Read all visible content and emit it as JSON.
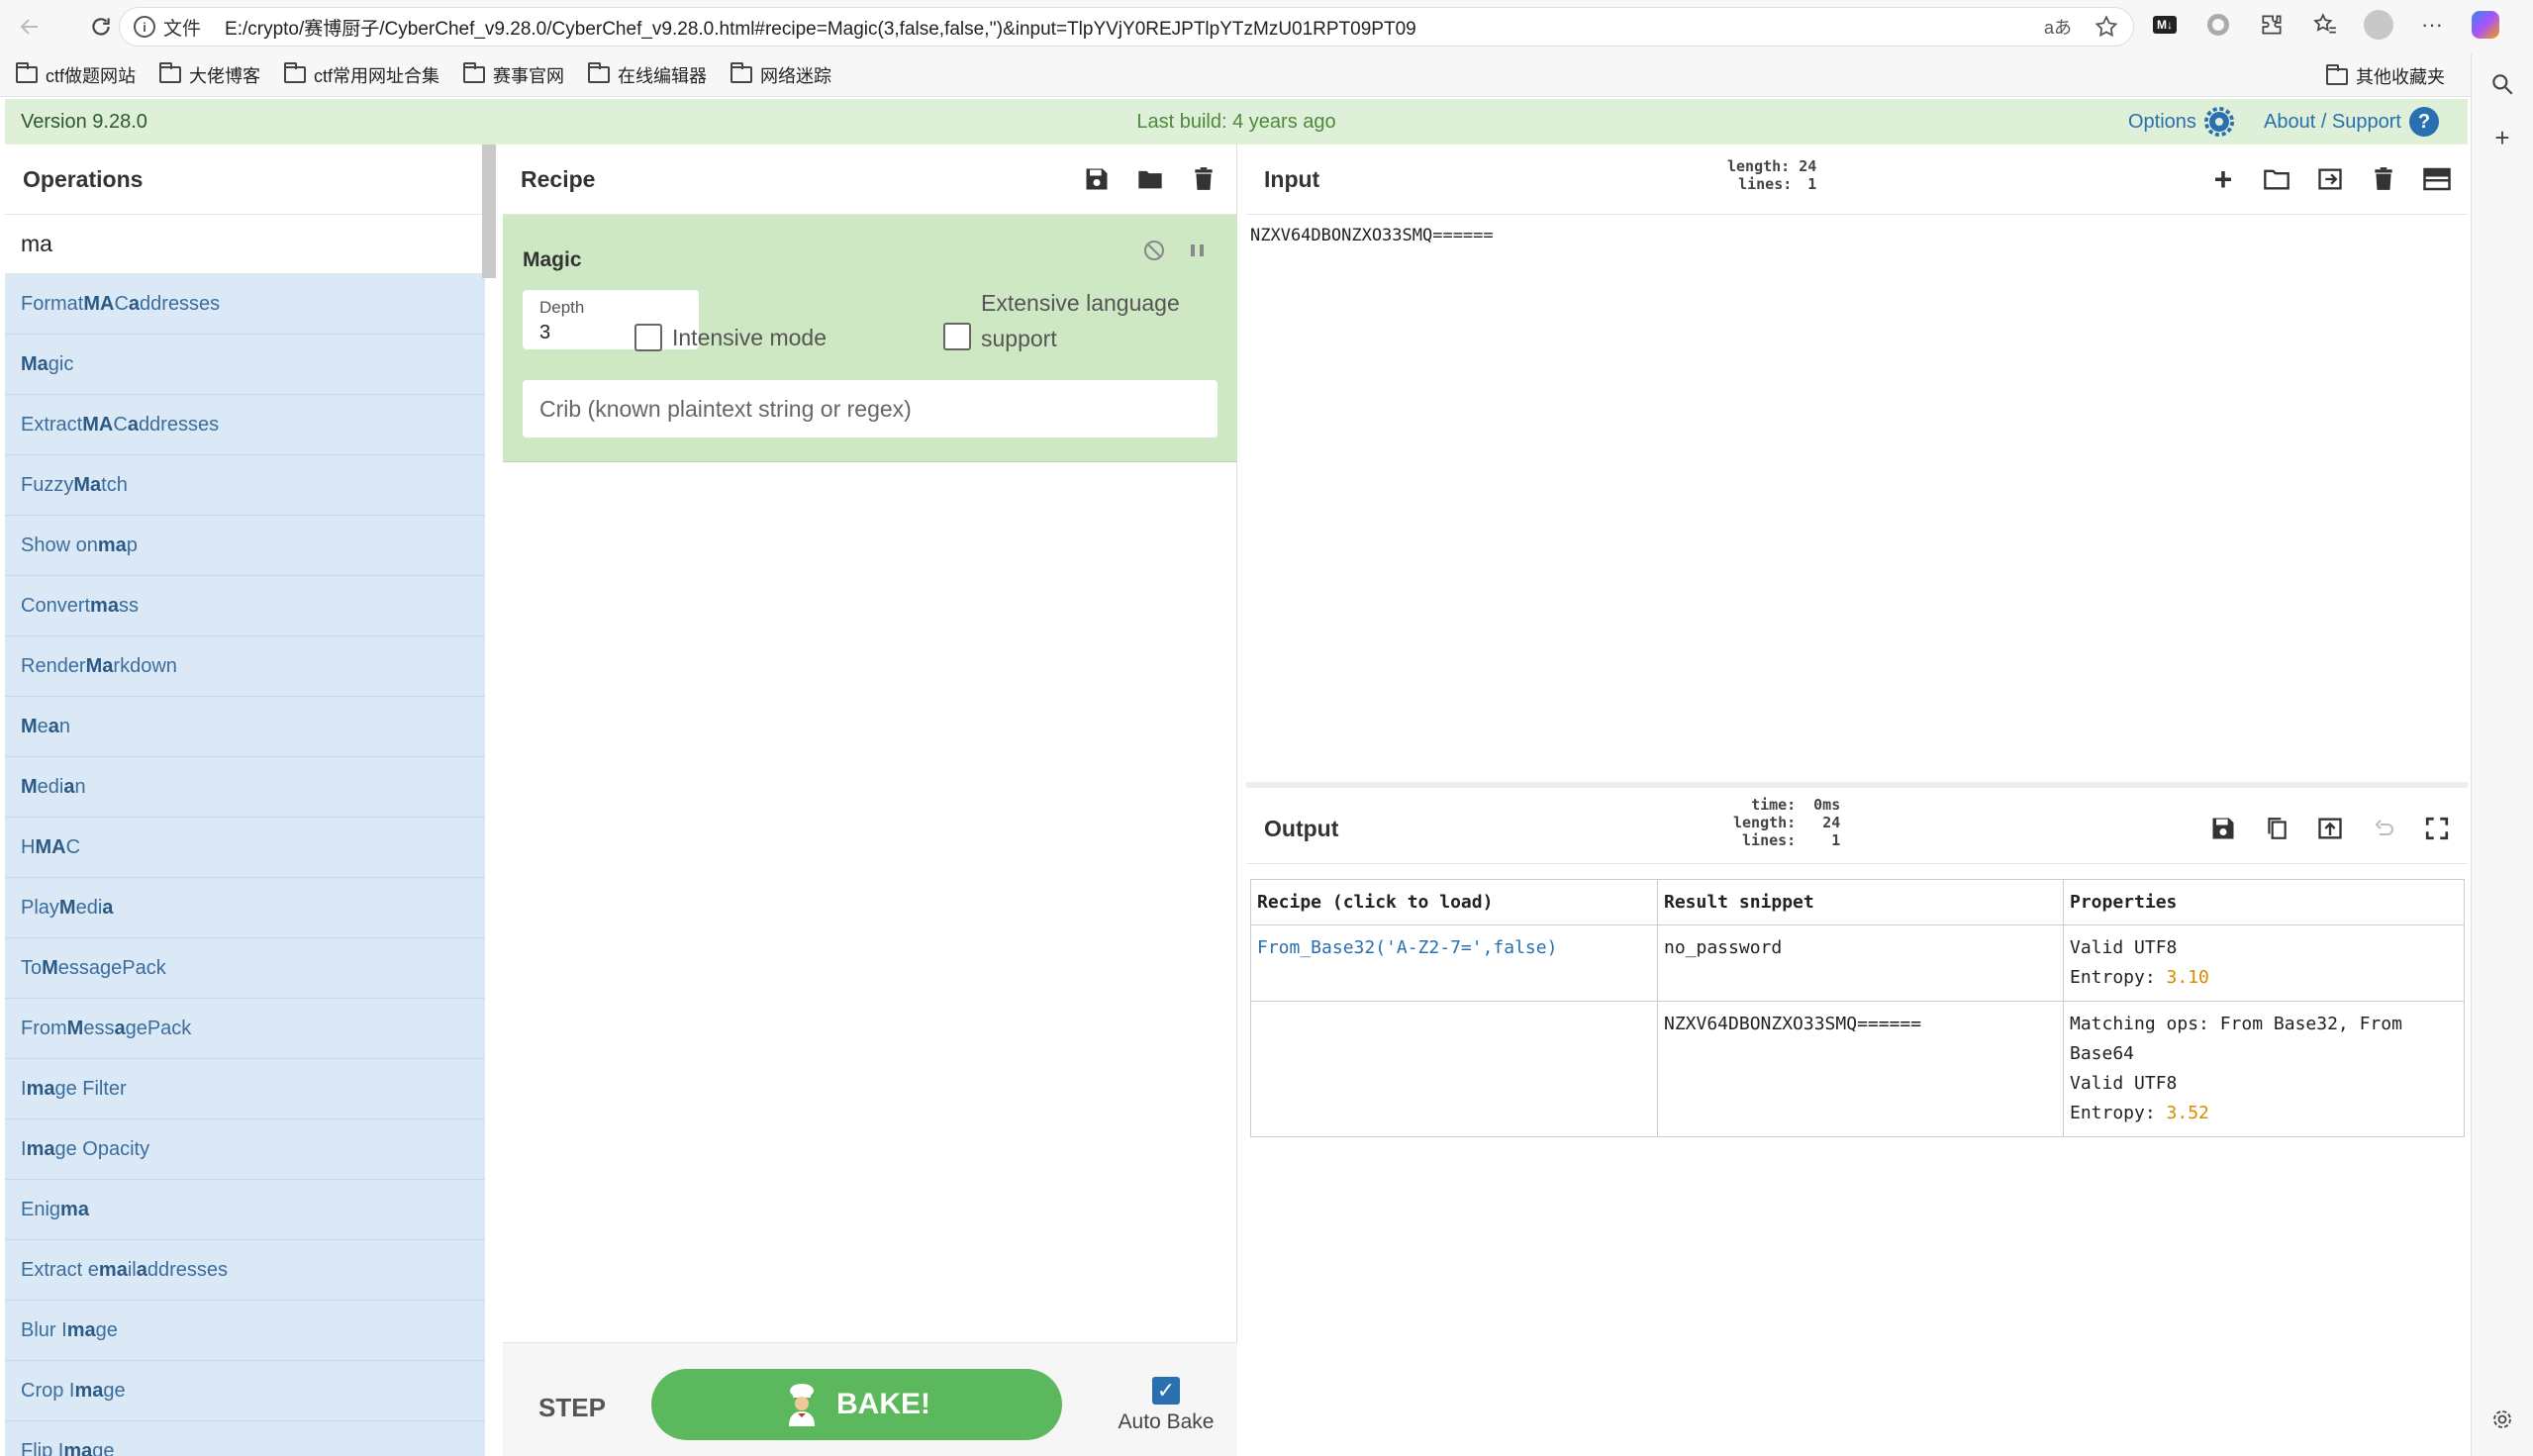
{
  "browser": {
    "file_label": "文件",
    "url": "E:/crypto/赛博厨子/CyberChef_v9.28.0/CyberChef_v9.28.0.html#recipe=Magic(3,false,false,'')&input=TlpYVjY0REJPTlpYTzMzU01RPT09PT09",
    "bookmarks": [
      "ctf做题网站",
      "大佬博客",
      "ctf常用网址合集",
      "赛事官网",
      "在线编辑器",
      "网络迷踪"
    ],
    "other_bookmarks": "其他收藏夹"
  },
  "banner": {
    "version": "Version 9.28.0",
    "last_build": "Last build: 4 years ago",
    "options": "Options",
    "about": "About / Support"
  },
  "operations": {
    "title": "Operations",
    "search_value": "ma",
    "items": [
      {
        "pre": "Format ",
        "hl": "MA",
        "mid": "C ",
        "hl2": "a",
        "post": "ddresses"
      },
      {
        "pre": "",
        "hl": "Ma",
        "mid": "gic",
        "hl2": "",
        "post": ""
      },
      {
        "pre": "Extract ",
        "hl": "MA",
        "mid": "C ",
        "hl2": "a",
        "post": "ddresses"
      },
      {
        "pre": "Fuzzy ",
        "hl": "Ma",
        "mid": "tch",
        "hl2": "",
        "post": ""
      },
      {
        "pre": "Show on ",
        "hl": "ma",
        "mid": "p",
        "hl2": "",
        "post": ""
      },
      {
        "pre": "Convert ",
        "hl": "ma",
        "mid": "ss",
        "hl2": "",
        "post": ""
      },
      {
        "pre": "Render ",
        "hl": "Ma",
        "mid": "rkdown",
        "hl2": "",
        "post": ""
      },
      {
        "pre": "",
        "hl": "M",
        "mid": "e",
        "hl2": "a",
        "post": "n"
      },
      {
        "pre": "",
        "hl": "M",
        "mid": "edi",
        "hl2": "a",
        "post": "n"
      },
      {
        "pre": "H",
        "hl": "MA",
        "mid": "C",
        "hl2": "",
        "post": ""
      },
      {
        "pre": "Play ",
        "hl": "M",
        "mid": "edi",
        "hl2": "a",
        "post": ""
      },
      {
        "pre": "To ",
        "hl": "M",
        "mid": "essagePack",
        "hl2": "",
        "post": ""
      },
      {
        "pre": "From ",
        "hl": "M",
        "mid": "ess",
        "hl2": "a",
        "post": "gePack"
      },
      {
        "pre": "I",
        "hl": "ma",
        "mid": "ge Filter",
        "hl2": "",
        "post": ""
      },
      {
        "pre": "I",
        "hl": "ma",
        "mid": "ge Opacity",
        "hl2": "",
        "post": ""
      },
      {
        "pre": "Enig",
        "hl": "ma",
        "mid": "",
        "hl2": "",
        "post": ""
      },
      {
        "pre": "Extract e",
        "hl": "ma",
        "mid": "il ",
        "hl2": "a",
        "post": "ddresses"
      },
      {
        "pre": "Blur I",
        "hl": "ma",
        "mid": "ge",
        "hl2": "",
        "post": ""
      },
      {
        "pre": "Crop I",
        "hl": "ma",
        "mid": "ge",
        "hl2": "",
        "post": ""
      },
      {
        "pre": "Flip I",
        "hl": "ma",
        "mid": "ge",
        "hl2": "",
        "post": ""
      }
    ]
  },
  "recipe": {
    "title": "Recipe",
    "op_name": "Magic",
    "depth_label": "Depth",
    "depth_value": "3",
    "intensive_label": "Intensive mode",
    "extensive_label_1": "Extensive language",
    "extensive_label_2": "support",
    "crib_placeholder": "Crib (known plaintext string or regex)",
    "step_label": "STEP",
    "bake_label": "BAKE!",
    "autobake_label": "Auto Bake"
  },
  "input": {
    "title": "Input",
    "length_label": "length:",
    "length_value": "24",
    "lines_label": "lines:",
    "lines_value": "1",
    "text": "NZXV64DBONZXO33SMQ======"
  },
  "output": {
    "title": "Output",
    "time_label": "time:",
    "time_value": "0ms",
    "length_label": "length:",
    "length_value": "24",
    "lines_label": "lines:",
    "lines_value": "1",
    "table": {
      "headers": [
        "Recipe (click to load)",
        "Result snippet",
        "Properties"
      ],
      "rows": [
        {
          "recipe": "From_Base32('A-Z2-7=',false)",
          "snippet": "no_password",
          "prop1": "Valid UTF8",
          "prop2": "",
          "prop3": "",
          "entropy_label": "Entropy: ",
          "entropy_value": "3.10"
        },
        {
          "recipe": "",
          "snippet": "NZXV64DBONZXO33SMQ======",
          "prop1": "Matching ops: From Base32, From",
          "prop2": "Base64",
          "prop3": "Valid UTF8",
          "entropy_label": "Entropy: ",
          "entropy_value": "3.52"
        }
      ]
    }
  },
  "colors": {
    "banner_bg": "#dff0d8",
    "op_list_bg": "#dbe9f6",
    "recipe_op_bg": "#cfe8c4",
    "bake_green": "#5cb85c",
    "link_blue": "#2a6fb0",
    "entropy_orange": "#d98a00"
  }
}
